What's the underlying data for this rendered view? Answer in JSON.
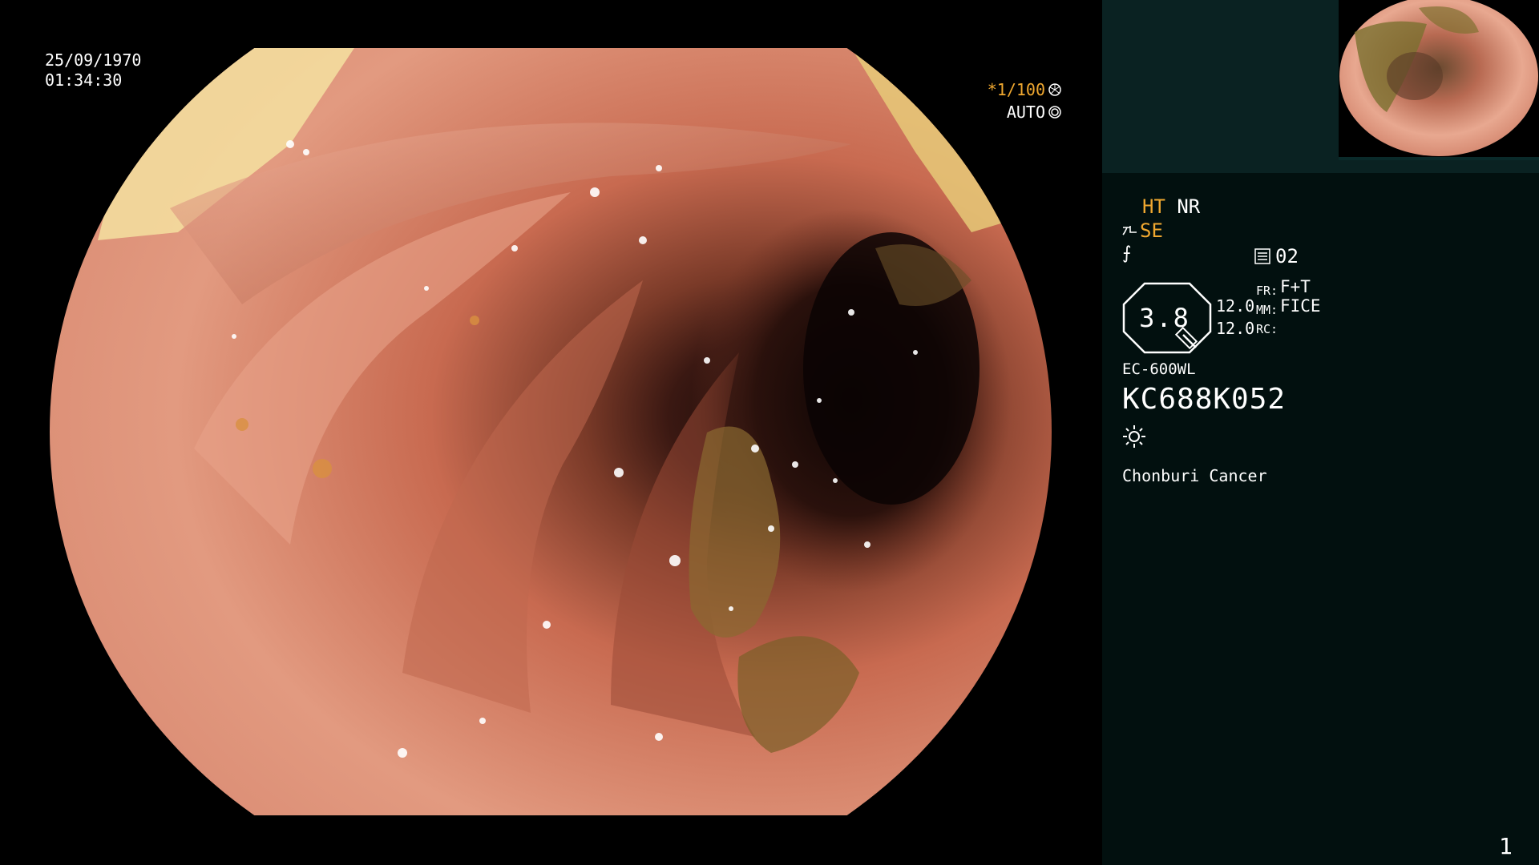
{
  "overlay": {
    "date": "25/09/1970",
    "time": "01:34:30",
    "shutter": "*1/100",
    "iris_mode": "AUTO",
    "shutter_icon": "aperture-icon",
    "iris_icon": "iris-icon"
  },
  "panel": {
    "ht": "HT",
    "nr": "NR",
    "se": "SE",
    "fx_symbol": "⨍",
    "memo_number": "02",
    "zoom": "3.8",
    "num1": "12.0",
    "num2": "12.0",
    "fr_label": "FR:",
    "fr_value": "F+T",
    "mm_label": "MM:",
    "mm_value": "FICE",
    "rc_label": "RC:",
    "rc_value": "",
    "scope_model": "EC-600WL",
    "serial": "KC688K052",
    "light_icon": "sun-icon",
    "hospital": "Chonburi Cancer",
    "page": "1"
  },
  "colors": {
    "accent": "#f0a830",
    "panel_bg": "#02100f",
    "panel_top_bg": "#0a2222"
  }
}
